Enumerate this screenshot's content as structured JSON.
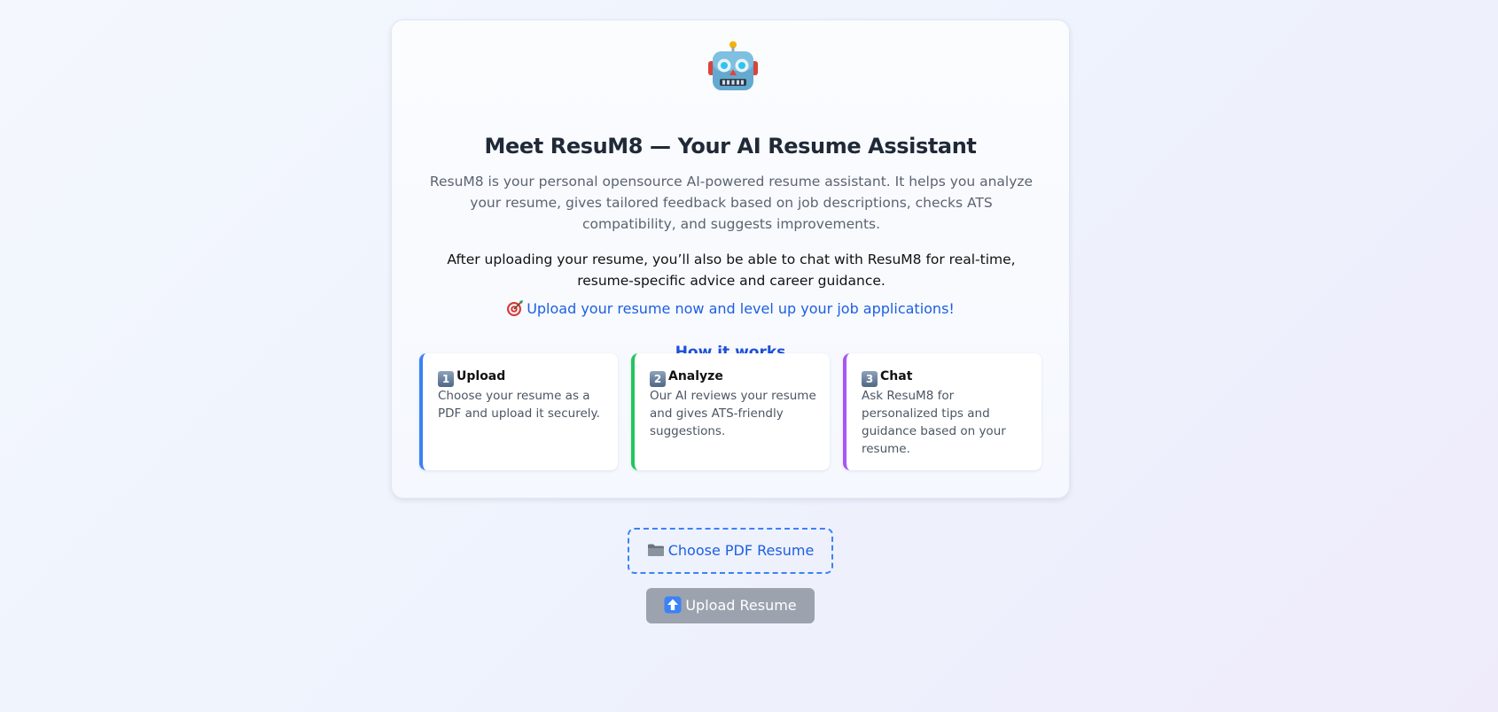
{
  "hero": {
    "icon": "robot-icon",
    "title": "Meet ResuM8 — Your AI Resume Assistant",
    "description": "ResuM8 is your personal opensource AI-powered resume assistant. It helps you analyze your resume, gives tailored feedback based on job descriptions, checks ATS compatibility, and suggests improvements.",
    "chat_note": "After uploading your resume, you’ll also be able to chat with ResuM8 for real-time, resume-specific advice and career guidance.",
    "cta_icon": "target-icon",
    "cta": "Upload your resume now and level up your job applications!"
  },
  "how_it_works": {
    "heading": "How it works",
    "steps": [
      {
        "number": "1",
        "title": "Upload",
        "text": "Choose your resume as a PDF and upload it securely.",
        "accent": "#3b82f6"
      },
      {
        "number": "2",
        "title": "Analyze",
        "text": "Our AI reviews your resume and gives ATS-friendly suggestions.",
        "accent": "#22c55e"
      },
      {
        "number": "3",
        "title": "Chat",
        "text": "Ask ResuM8 for personalized tips and guidance based on your resume.",
        "accent": "#a855f7"
      }
    ]
  },
  "actions": {
    "choose_icon": "folder-icon",
    "choose_label": "Choose PDF Resume",
    "upload_icon": "up-arrow-icon",
    "upload_label": "Upload Resume",
    "upload_disabled": true
  },
  "colors": {
    "brand_blue": "#1d5fe0",
    "disabled_gray": "#9ca3af"
  }
}
